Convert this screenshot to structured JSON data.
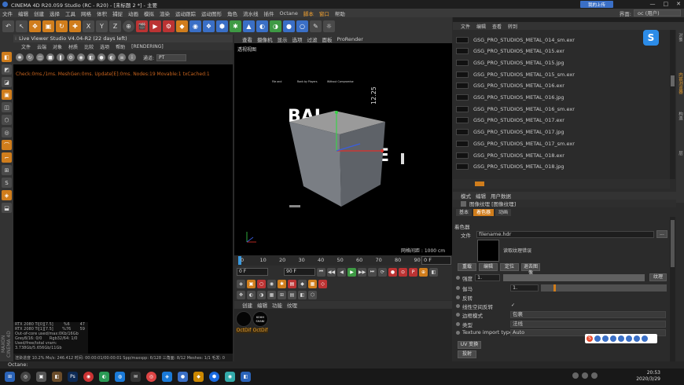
{
  "window": {
    "title": "CINEMA 4D R20.059 Studio (RC - R20) - [未标题 2 *] - 主要",
    "controls": [
      "—",
      "□",
      "✕"
    ],
    "cloud_button": "我的上传"
  },
  "menubar": {
    "items": [
      "文件",
      "编辑",
      "创建",
      "选择",
      "工具",
      "网格",
      "体积",
      "捕捉",
      "动画",
      "模拟",
      "渲染",
      "运动跟踪",
      "运动图形",
      "角色",
      "流水线",
      "插件",
      "Octane",
      "脚本",
      "窗口",
      "帮助"
    ],
    "highlighted": [
      "脚本",
      "窗口"
    ],
    "interface_label": "界面:",
    "interface_value": "oc (用户)"
  },
  "toolbar": {
    "buttons": [
      "↶",
      "↖",
      "✥",
      "▣",
      "↻",
      "✚",
      "X",
      "Y",
      "Z",
      "⊕",
      "🎬",
      "▶",
      "⚙",
      "◆",
      "◉",
      "❖",
      "⬢",
      "✱",
      "▲",
      "◐",
      "◑",
      "●",
      "○",
      "✎",
      "☼"
    ]
  },
  "left_tools": [
    "◧",
    "◩",
    "◪",
    "▣",
    "◫",
    "⬡",
    "◎",
    "⌒",
    "⌐",
    "⊞",
    "S",
    "◈",
    "⬓"
  ],
  "left_logo": "MAXON CINEMA 4D",
  "live_viewer": {
    "title": "Live Viewer Studio V4.04-R2 (22 days left)",
    "menu": [
      "文件",
      "云端",
      "对象",
      "材质",
      "比较",
      "选项",
      "帮助",
      "[RENDERING]"
    ],
    "channel_label": "通道:",
    "channel_value": "PT",
    "status_line": "Check:0ms./1ms. MeshGen:0ms. Update[E]:0ms. Nodes:19 Movable:1 txCached:1",
    "stats": [
      {
        "k": "RTX 2080 Ti[0][7.5]",
        "a": "%6",
        "b": "47"
      },
      {
        "k": "RTX 2080 Ti[1][7.5]",
        "a": "%76",
        "b": "59"
      },
      {
        "k": "Out-of-core used/max:0Kb/16Gb",
        "a": "",
        "b": ""
      },
      {
        "k": "Grey8/16: 0/0",
        "a": "Rgb32/64: 1/0",
        "b": ""
      },
      {
        "k": "Used/free/total vram: 3.738Gb/5.656Gb/11Gb",
        "a": "",
        "b": ""
      }
    ],
    "bottom_bar": "渲染进度 10.2%  Ms/s: 246.412  时间: 00:00:01/00:00:01  Spp/maxspp: 6/128  三角面: 8/12  Meshes: 1/1  毛发: 0"
  },
  "viewport": {
    "menu": [
      "查看",
      "摄像机",
      "显示",
      "选项",
      "过滤",
      "面板",
      "ProRender"
    ],
    "label": "透视视图",
    "grid_info": "网格间距 : 1000 cm",
    "backdrop_big_text": "BAL",
    "backdrop_big_text2": "E",
    "backdrop_num": "12.25",
    "backdrop_small": [
      "File and",
      "Rank by Players",
      "Without Compromise"
    ]
  },
  "timeline": {
    "ticks": [
      "0",
      "10",
      "20",
      "30",
      "40",
      "50",
      "60",
      "70",
      "80",
      "90"
    ],
    "frame": "0 F",
    "start_field": "0 F",
    "end_field": "90 F",
    "transport_buttons": [
      "⏮",
      "◀◀",
      "◀",
      "▶",
      "▶▶",
      "⏭",
      "⟳",
      "●",
      "⊙",
      "P",
      "⊕",
      "◧"
    ]
  },
  "material_manager": {
    "menu": [
      "创建",
      "编辑",
      "功能",
      "纹理"
    ],
    "materials": [
      {
        "name": "OctDif",
        "ball_text": ""
      },
      {
        "name": "OctDif",
        "ball_text": "KOHH SHANI"
      }
    ]
  },
  "file_browser": {
    "menu": [
      "文件",
      "编辑",
      "查看",
      "转到"
    ],
    "files": [
      "GSG_PRO_STUDIOS_METAL_014_sm.exr",
      "GSG_PRO_STUDIOS_METAL_015.exr",
      "GSG_PRO_STUDIOS_METAL_015.jpg",
      "GSG_PRO_STUDIOS_METAL_015_sm.exr",
      "GSG_PRO_STUDIOS_METAL_016.exr",
      "GSG_PRO_STUDIOS_METAL_016.jpg",
      "GSG_PRO_STUDIOS_METAL_016_sm.exr",
      "GSG_PRO_STUDIOS_METAL_017.exr",
      "GSG_PRO_STUDIOS_METAL_017.jpg",
      "GSG_PRO_STUDIOS_METAL_017_sm.exr",
      "GSG_PRO_STUDIOS_METAL_018.exr",
      "GSG_PRO_STUDIOS_METAL_018.jpg"
    ],
    "right_strip": [
      "对象",
      "内容浏览器",
      "构造",
      "层"
    ]
  },
  "attribute_manager": {
    "menu": [
      "模式",
      "编辑",
      "用户数据"
    ],
    "title": "图像纹理 [图像纹理]",
    "tabs": [
      "基本",
      "着色器",
      "动画"
    ],
    "active_tab": "着色器",
    "section": "着色器",
    "file_label": "文件",
    "file_value": "filename.hdr",
    "file_button": "...",
    "preview_text": "读取纹理错误",
    "buttons": [
      "重载",
      "编辑",
      "定位",
      "退去图像"
    ],
    "props": [
      {
        "label": "强度",
        "value": "1.",
        "btn": "纹理"
      },
      {
        "label": "伽马",
        "value": "1."
      },
      {
        "label": "反转",
        "value": ""
      },
      {
        "label": "线性空间反转",
        "value": "✓"
      },
      {
        "label": "边框模式",
        "value": "包裹"
      },
      {
        "label": "类型",
        "value": "法线"
      },
      {
        "label": "Texture import type",
        "value": "Auto"
      }
    ],
    "uv_button": "UV 变换",
    "projection_button": "投射"
  },
  "status_bar": {
    "text": "Octane:"
  },
  "taskbar": {
    "icons": [
      "⊞",
      "◎",
      "▣",
      "◧",
      "Ps",
      "◉",
      "◐",
      "◍",
      "✉",
      "◎",
      "◈",
      "●",
      "◆",
      "⬢",
      "◉",
      "◧"
    ],
    "time": "20:53",
    "date": "2020/3/29"
  },
  "colors": {
    "accent": "#d07d1c",
    "panel": "#2b2b2b",
    "status_text": "#c8641e"
  }
}
